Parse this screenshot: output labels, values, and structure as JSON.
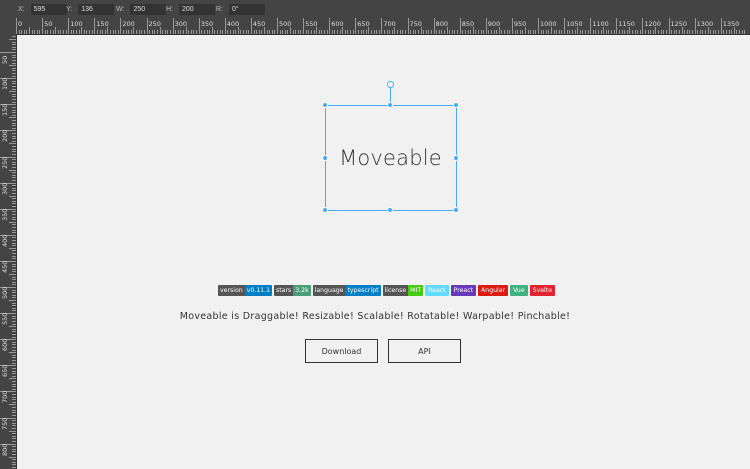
{
  "infobar": {
    "fields": [
      {
        "label": "X:",
        "value": "595"
      },
      {
        "label": "Y:",
        "value": "136"
      },
      {
        "label": "W:",
        "value": "250"
      },
      {
        "label": "H:",
        "value": "200"
      },
      {
        "label": "R:",
        "value": "0°"
      }
    ]
  },
  "ruler": {
    "h_labels": [
      "0",
      "50",
      "100",
      "150",
      "200",
      "250",
      "300",
      "350",
      "400",
      "450",
      "500",
      "550",
      "600",
      "650",
      "700",
      "750",
      "800",
      "850",
      "900",
      "950",
      "1000",
      "1050",
      "1100",
      "1150",
      "1200",
      "1250",
      "1300",
      "1350"
    ],
    "v_labels": [
      "50",
      "100",
      "150",
      "200",
      "250",
      "300",
      "350",
      "400",
      "450",
      "500",
      "550",
      "600",
      "650",
      "700",
      "750",
      "800"
    ]
  },
  "target": {
    "label": "Moveable"
  },
  "badges": [
    {
      "key": "version",
      "value": "v0.11.1",
      "color": "#007ec6"
    },
    {
      "key": "stars",
      "value": "3.2k",
      "color": "#4c9e7b"
    },
    {
      "key": "language",
      "value": "typescript",
      "color": "#007ec6"
    },
    {
      "key": "license",
      "value": "MIT",
      "color": "#4c1"
    },
    {
      "label": "React",
      "color": "#61dafb"
    },
    {
      "label": "Preact",
      "color": "#673ab8"
    },
    {
      "label": "Angular",
      "color": "#dd1b16"
    },
    {
      "label": "Vue",
      "color": "#3fb27f"
    },
    {
      "label": "Svelte",
      "color": "#e4222d"
    }
  ],
  "tagline": "Moveable is Draggable! Resizable! Scalable! Rotatable! Warpable! Pinchable!",
  "buttons": {
    "download": "Download",
    "api": "API"
  }
}
